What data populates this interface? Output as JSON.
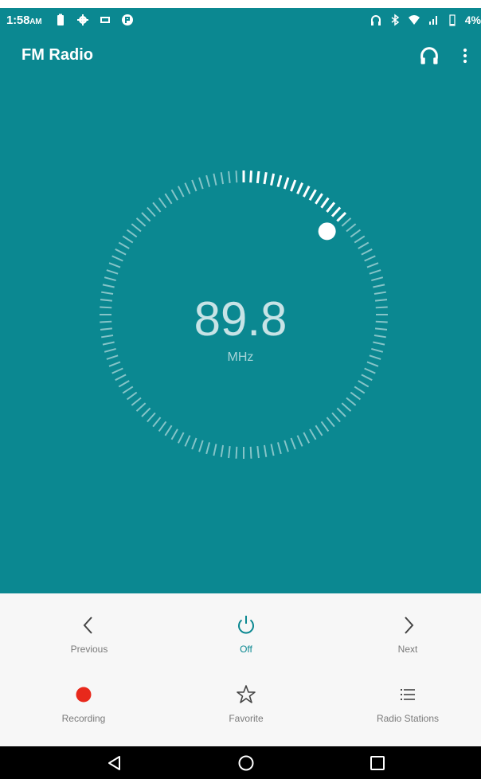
{
  "status_bar": {
    "time": "1:58",
    "ampm": "AM",
    "battery_percent": "4%"
  },
  "toolbar": {
    "title": "FM Radio"
  },
  "tuner": {
    "frequency": "89.8",
    "unit": "MHz",
    "dial_level_fraction": 0.125
  },
  "controls": {
    "previous_label": "Previous",
    "off_label": "Off",
    "next_label": "Next",
    "recording_label": "Recording",
    "favorite_label": "Favorite",
    "stations_label": "Radio Stations"
  },
  "colors": {
    "background": "#0b8891",
    "accent": "#0b8891",
    "record": "#e8291c"
  },
  "icons": {
    "headphones": "headphones-icon",
    "overflow": "more-vert-icon",
    "previous": "chevron-left-icon",
    "power": "power-icon",
    "next": "chevron-right-icon",
    "record": "record-dot-icon",
    "favorite": "star-outline-icon",
    "stations": "list-icon",
    "back": "back-triangle-icon",
    "home": "home-circle-icon",
    "recents": "recents-square-icon"
  }
}
